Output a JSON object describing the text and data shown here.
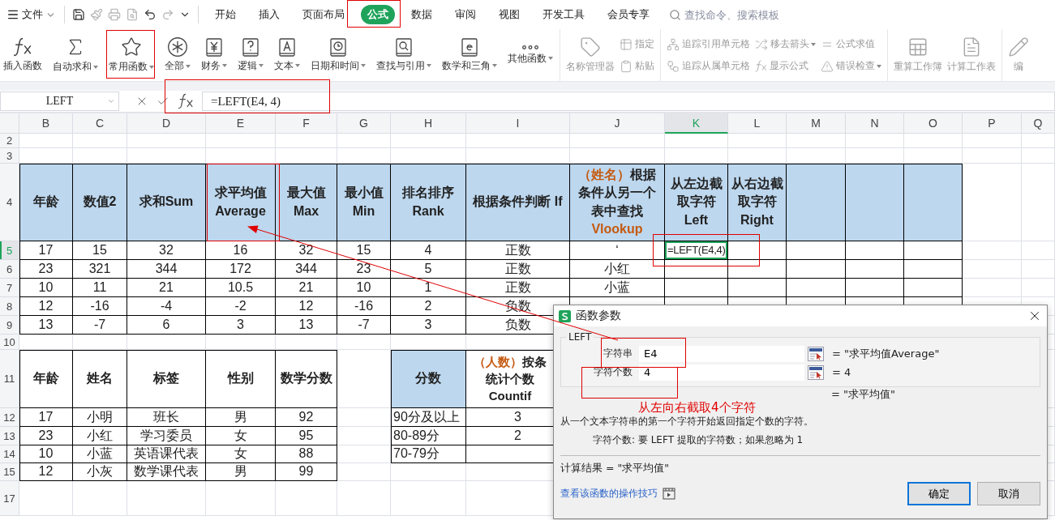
{
  "menu": {
    "file": "文件"
  },
  "tabs": [
    {
      "label": "开始",
      "selected": false
    },
    {
      "label": "插入",
      "selected": false
    },
    {
      "label": "页面布局",
      "selected": false
    },
    {
      "label": "公式",
      "selected": true
    },
    {
      "label": "数据",
      "selected": false
    },
    {
      "label": "审阅",
      "selected": false
    },
    {
      "label": "视图",
      "selected": false
    },
    {
      "label": "开发工具",
      "selected": false
    },
    {
      "label": "会员专享",
      "selected": false
    }
  ],
  "search": {
    "placeholder": "查找命令、搜索模板"
  },
  "ribbon": {
    "functions": [
      {
        "label": "插入函数",
        "dropdown": false
      },
      {
        "label": "自动求和",
        "dropdown": true
      },
      {
        "label": "常用函数",
        "dropdown": true
      },
      {
        "label": "全部",
        "dropdown": true
      },
      {
        "label": "财务",
        "dropdown": true
      },
      {
        "label": "逻辑",
        "dropdown": true
      },
      {
        "label": "文本",
        "dropdown": true
      },
      {
        "label": "日期和时间",
        "dropdown": true
      },
      {
        "label": "查找与引用",
        "dropdown": true
      },
      {
        "label": "数学和三角",
        "dropdown": true
      },
      {
        "label": "其他函数",
        "dropdown": true
      }
    ],
    "tool_sections": [
      [
        {
          "kind": "large",
          "items": [
            {
              "label": "名称管理器",
              "dropdown": false,
              "disabled": true
            }
          ]
        },
        {
          "kind": "stack",
          "items": [
            {
              "label": "指定",
              "dropdown": false,
              "disabled": true
            },
            {
              "label": "粘贴",
              "dropdown": false,
              "disabled": true
            }
          ]
        }
      ],
      [
        {
          "kind": "stack",
          "items": [
            {
              "label": "追踪引用单元格",
              "dropdown": false,
              "disabled": true
            },
            {
              "label": "追踪从属单元格",
              "dropdown": false,
              "disabled": true
            }
          ]
        },
        {
          "kind": "stack",
          "items": [
            {
              "label": "移去箭头",
              "dropdown": true,
              "disabled": true
            },
            {
              "label": "显示公式",
              "dropdown": false,
              "disabled": true
            }
          ]
        },
        {
          "kind": "stack",
          "items": [
            {
              "label": "公式求值",
              "dropdown": false,
              "disabled": true
            },
            {
              "label": "错误检查",
              "dropdown": true,
              "disabled": true
            }
          ]
        }
      ],
      [
        {
          "kind": "large",
          "items": [
            {
              "label": "重算工作簿",
              "dropdown": false,
              "disabled": true
            }
          ]
        },
        {
          "kind": "large",
          "items": [
            {
              "label": "计算工作表",
              "dropdown": false,
              "disabled": true
            }
          ]
        }
      ],
      [
        {
          "kind": "large",
          "items": [
            {
              "label": "编",
              "dropdown": false,
              "disabled": true
            }
          ]
        }
      ]
    ]
  },
  "formula_bar": {
    "name_box": "LEFT",
    "formula": "=LEFT(E4, 4)"
  },
  "sheet": {
    "columns": [
      {
        "label": "B",
        "selected": false
      },
      {
        "label": "C",
        "selected": false
      },
      {
        "label": "D",
        "selected": false
      },
      {
        "label": "E",
        "selected": false
      },
      {
        "label": "F",
        "selected": false
      },
      {
        "label": "G",
        "selected": false
      },
      {
        "label": "H",
        "selected": false
      },
      {
        "label": "I",
        "selected": false
      },
      {
        "label": "J",
        "selected": false
      },
      {
        "label": "K",
        "selected": true
      },
      {
        "label": "L",
        "selected": false
      },
      {
        "label": "M",
        "selected": false
      },
      {
        "label": "N",
        "selected": false
      },
      {
        "label": "O",
        "selected": false
      },
      {
        "label": "P",
        "selected": false
      },
      {
        "label": "Q",
        "selected": false
      }
    ],
    "rows": [
      {
        "label": "2",
        "selected": false
      },
      {
        "label": "3",
        "selected": false
      },
      {
        "label": "4",
        "selected": false
      },
      {
        "label": "5",
        "selected": true
      },
      {
        "label": "6",
        "selected": false
      },
      {
        "label": "7",
        "selected": false
      },
      {
        "label": "8",
        "selected": false
      },
      {
        "label": "9",
        "selected": false
      },
      {
        "label": "10",
        "selected": false
      },
      {
        "label": "11",
        "selected": false
      },
      {
        "label": "12",
        "selected": false
      },
      {
        "label": "13",
        "selected": false
      },
      {
        "label": "14",
        "selected": false
      },
      {
        "label": "15",
        "selected": false
      },
      {
        "label": "17",
        "selected": false
      }
    ],
    "active_cell": {
      "value": "=LEFT(E4,4)"
    },
    "tables": [
      {
        "kind": "stats",
        "headers": [
          {
            "parts": [
              {
                "text": "年龄",
                "accent": false
              }
            ],
            "shaded": true
          },
          {
            "parts": [
              {
                "text": "数值2",
                "accent": false
              }
            ],
            "shaded": true
          },
          {
            "parts": [
              {
                "text": "求和Sum",
                "accent": false
              }
            ],
            "shaded": true
          },
          {
            "parts": [
              {
                "text": "求平均值 Average",
                "accent": false
              }
            ],
            "shaded": true
          },
          {
            "parts": [
              {
                "text": "最大值 Max",
                "accent": false
              }
            ],
            "shaded": true
          },
          {
            "parts": [
              {
                "text": "最小值 Min",
                "accent": false
              }
            ],
            "shaded": true
          },
          {
            "parts": [
              {
                "text": "排名排序 Rank",
                "accent": false
              }
            ],
            "shaded": true
          },
          {
            "parts": [
              {
                "text": "根据条件判断 If",
                "accent": false
              }
            ],
            "shaded": true
          },
          {
            "parts": [
              {
                "text": "（姓名）",
                "accent": true
              },
              {
                "text": "根据条件从另一个表中查找 ",
                "accent": false
              },
              {
                "text": "Vlookup",
                "accent": true
              }
            ],
            "shaded": true
          },
          {
            "parts": [
              {
                "text": "从左边截取字符 Left",
                "accent": false
              }
            ],
            "shaded": true
          },
          {
            "parts": [
              {
                "text": "从右边截取字符 Right",
                "accent": false
              }
            ],
            "shaded": true
          },
          {
            "shaded": true
          },
          {
            "shaded": true
          },
          {
            "shaded": true
          }
        ],
        "rows": [
          [
            "17",
            "15",
            "32",
            "16",
            "32",
            "15",
            "4",
            "正数",
            "ʻ"
          ],
          [
            "23",
            "321",
            "344",
            "172",
            "344",
            "23",
            "5",
            "正数",
            "小红"
          ],
          [
            "10",
            "11",
            "21",
            "10.5",
            "21",
            "10",
            "1",
            "正数",
            "小蓝"
          ],
          [
            "12",
            "-16",
            "-4",
            "-2",
            "12",
            "-16",
            "2",
            "负数"
          ],
          [
            "13",
            "-7",
            "6",
            "3",
            "13",
            "-7",
            "3",
            "负数"
          ]
        ]
      },
      {
        "kind": "roster",
        "headers": [
          {
            "parts": [
              {
                "text": "年龄",
                "accent": false
              }
            ],
            "shaded": false
          },
          {
            "parts": [
              {
                "text": "姓名",
                "accent": false
              }
            ],
            "shaded": false
          },
          {
            "parts": [
              {
                "text": "标签",
                "accent": false
              }
            ],
            "shaded": false
          },
          {
            "parts": [
              {
                "text": "性别",
                "accent": false
              }
            ],
            "shaded": false
          },
          {
            "parts": [
              {
                "text": "数学分数",
                "accent": false
              }
            ],
            "shaded": false
          }
        ],
        "rows": [
          [
            "17",
            "小明",
            "班长",
            "男",
            "92"
          ],
          [
            "23",
            "小红",
            "学习委员",
            "女",
            "95"
          ],
          [
            "10",
            "小蓝",
            "英语课代表",
            "女",
            "88"
          ],
          [
            "12",
            "小灰",
            "数学课代表",
            "男",
            "99"
          ]
        ]
      },
      {
        "kind": "ranges",
        "headers": [
          {
            "parts": [
              {
                "text": "分数",
                "accent": false
              }
            ],
            "shaded": true
          },
          {
            "parts": [
              {
                "text": "（人数）",
                "accent": true
              },
              {
                "text": "按条统计个数 Countif",
                "accent": false
              }
            ],
            "shaded": false
          }
        ],
        "rows": [
          [
            "90分及以上",
            "3"
          ],
          [
            "80-89分",
            "2"
          ],
          [
            "70-79分"
          ]
        ]
      }
    ]
  },
  "dialog": {
    "title": "函数参数",
    "function": "LEFT",
    "args": [
      {
        "label": "字符串",
        "value": "E4",
        "result": "= \"求平均值Average\""
      },
      {
        "label": "字符个数",
        "value": "4",
        "result": "= 4"
      }
    ],
    "value": "= \"求平均值\"",
    "description": "从一个文本字符串的第一个字符开始返回指定个数的字符。",
    "arg_help": "字符个数:  要 LEFT 提取的字符数；如果忽略为 1",
    "result": "计算结果  =  \"求平均值\"",
    "help_link": "查看该函数的操作技巧",
    "buttons": [
      {
        "label": "确定",
        "default": true
      },
      {
        "label": "取消",
        "default": false
      }
    ]
  },
  "annotation": {
    "note": "从左向右截取4个字符"
  }
}
